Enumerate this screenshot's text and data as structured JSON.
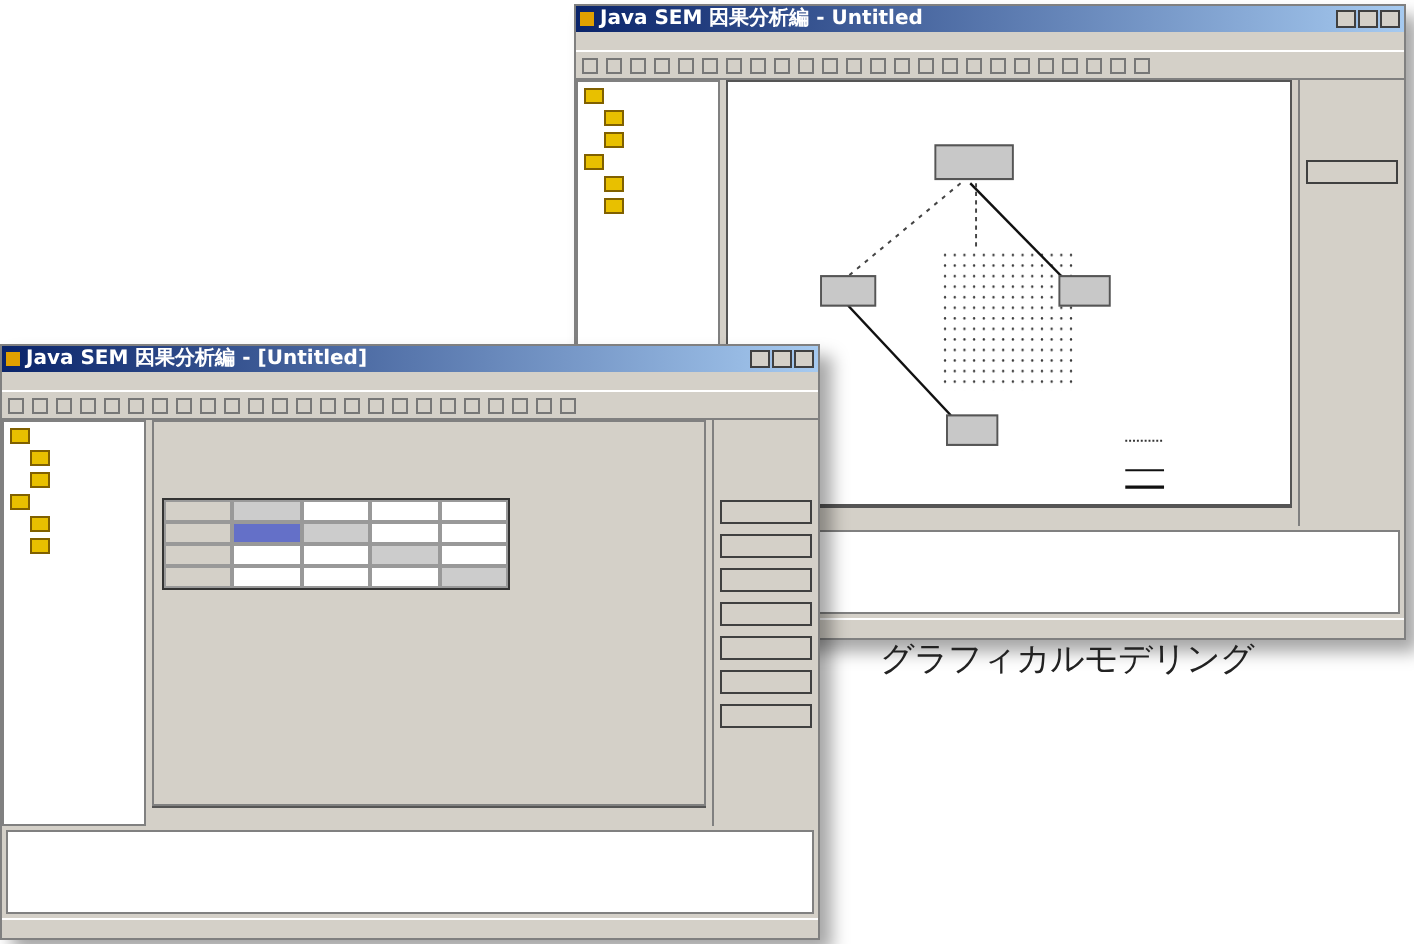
{
  "windows": [
    {
      "kind": "diagram",
      "title": "Java SEM 因果分析編 - Untitled"
    },
    {
      "kind": "table",
      "title": "Java SEM 因果分析編 - [Untitled]"
    }
  ],
  "caption": "グラフィカルモデリング"
}
